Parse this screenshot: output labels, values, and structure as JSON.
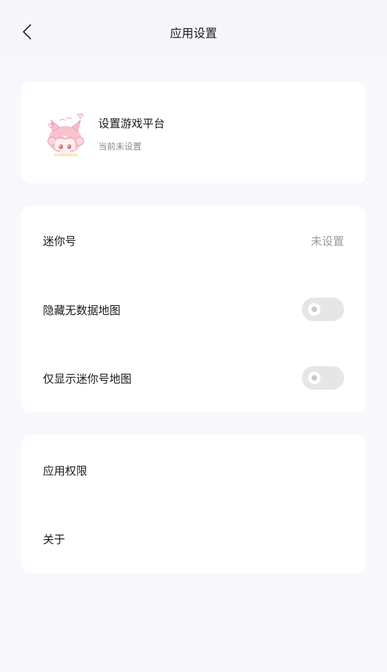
{
  "header": {
    "title": "应用设置",
    "back_icon": "chevron-left-icon"
  },
  "platform_card": {
    "title": "设置游戏平台",
    "subtitle": "当前未设置",
    "avatar_icon": "anime-girl-avatar"
  },
  "settings_card": {
    "mini_id": {
      "label": "迷你号",
      "value": "未设置"
    },
    "hide_no_data_maps": {
      "label": "隐藏无数据地图",
      "enabled": false
    },
    "only_mini_id_maps": {
      "label": "仅显示迷你号地图",
      "enabled": false
    }
  },
  "about_card": {
    "permissions": {
      "label": "应用权限"
    },
    "about": {
      "label": "关于"
    }
  },
  "colors": {
    "background": "#f8f7fc",
    "card": "#ffffff",
    "toggle_off": "#e6e6e6",
    "muted_text": "#9a9a9a"
  }
}
